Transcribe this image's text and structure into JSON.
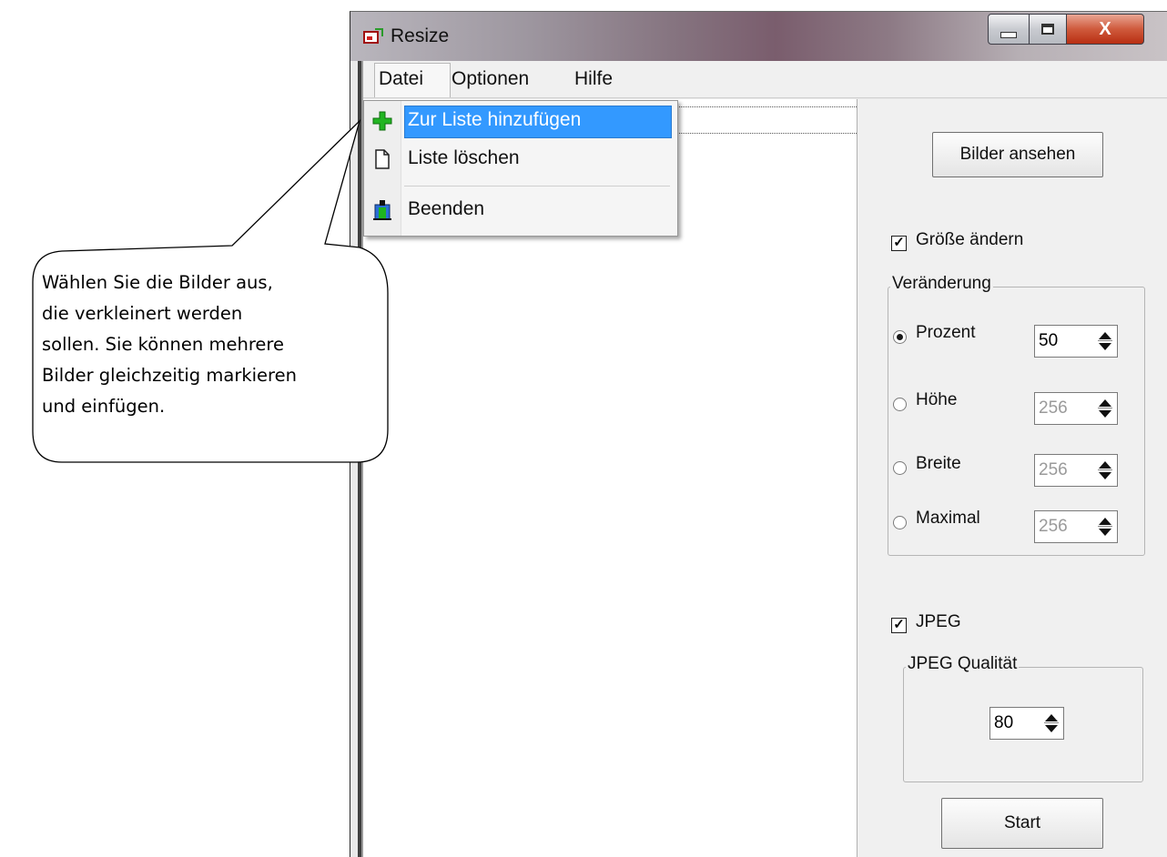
{
  "window": {
    "title": "Resize",
    "close_glyph": "X"
  },
  "menu": {
    "datei": "Datei",
    "optionen": "Optionen",
    "hilfe": "Hilfe"
  },
  "dropdown": {
    "items": [
      {
        "label": "Zur Liste hinzufügen",
        "icon": "green-plus-icon"
      },
      {
        "label": "Liste löschen",
        "icon": "blank-document-icon"
      },
      {
        "label": "Beenden",
        "icon": "exit-door-icon"
      }
    ]
  },
  "panel": {
    "view_button": "Bilder ansehen",
    "resize_checkbox": {
      "label": "Größe ändern",
      "checked": true
    },
    "group_change": {
      "legend": "Veränderung",
      "options": [
        {
          "label": "Prozent",
          "value": "50",
          "selected": true
        },
        {
          "label": "Höhe",
          "value": "256",
          "selected": false
        },
        {
          "label": "Breite",
          "value": "256",
          "selected": false
        },
        {
          "label": "Maximal",
          "value": "256",
          "selected": false
        }
      ]
    },
    "jpeg_checkbox": {
      "label": "JPEG",
      "checked": true
    },
    "group_quality": {
      "legend": "JPEG Qualität",
      "value": "80"
    },
    "start_button": "Start"
  },
  "callout": {
    "lines": [
      "Wählen Sie die Bilder aus,",
      "die verkleinert werden",
      "sollen. Sie können mehrere",
      "Bilder gleichzeitig markieren",
      "und einfügen."
    ]
  },
  "colors": {
    "menu_highlight": "#3399ff",
    "close_button": "#c7452a"
  }
}
